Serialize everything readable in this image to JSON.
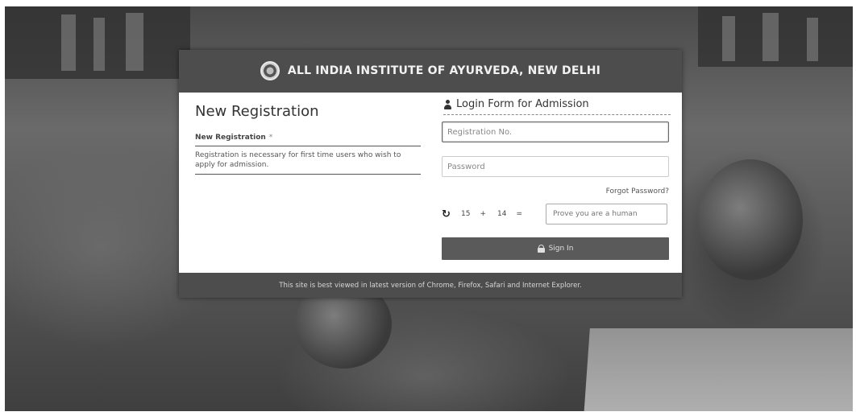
{
  "header": {
    "institute_name": "ALL INDIA INSTITUTE OF AYURVEDA, NEW DELHI",
    "logo_icon": "institute-emblem-icon"
  },
  "new_registration": {
    "title": "New Registration",
    "subtitle": "New Registration",
    "subtitle_marker": "*",
    "description": "Registration is necessary for first time users who wish to apply for admission."
  },
  "login": {
    "title": "Login Form for Admission",
    "title_icon": "user-icon",
    "registration_placeholder": "Registration No.",
    "password_placeholder": "Password",
    "forgot_label": "Forgot Password?",
    "captcha": {
      "refresh_icon": "refresh-icon",
      "operand_a": "15",
      "operator": "+",
      "operand_b": "14",
      "equals": "=",
      "placeholder": "Prove you are a human"
    },
    "signin_label": "Sign In",
    "signin_icon": "lock-icon"
  },
  "footer": {
    "text": "This site is best viewed in latest version of Chrome, Firefox, Safari and Internet Explorer."
  },
  "colors": {
    "panel_bg": "#4d4d4d",
    "card_bg": "#ffffff",
    "button_bg": "#5a5a5a",
    "photo_bg": "#5e5e5e"
  }
}
